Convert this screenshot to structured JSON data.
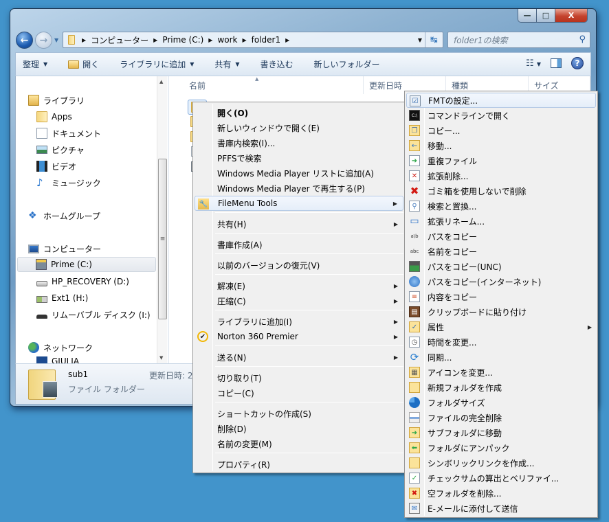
{
  "window": {
    "caption_buttons": {
      "minimize": "—",
      "maximize": "□",
      "close": "X"
    },
    "nav": {
      "back_icon": "back-arrow-icon",
      "forward_icon": "forward-arrow-icon"
    },
    "address": {
      "segments": [
        "コンピューター",
        "Prime (C:)",
        "work",
        "folder1"
      ],
      "separator": "▶"
    },
    "search": {
      "placeholder": "folder1の検索"
    },
    "toolbar": {
      "organize": "整理",
      "open": "開く",
      "add_to_library": "ライブラリに追加",
      "share": "共有",
      "burn": "書き込む",
      "new_folder": "新しいフォルダー"
    },
    "nav_pane": {
      "libraries": "ライブラリ",
      "lib_items": [
        "Apps",
        "ドキュメント",
        "ピクチャ",
        "ビデオ",
        "ミュージック"
      ],
      "homegroup": "ホームグループ",
      "computer": "コンピューター",
      "drives": [
        "Prime (C:)",
        "HP_RECOVERY (D:)",
        "Ext1 (H:)",
        "リムーバブル ディスク (I:)"
      ],
      "network": "ネットワーク",
      "network_items": [
        "GIULIA"
      ]
    },
    "columns": [
      "名前",
      "更新日時",
      "種類",
      "サイズ"
    ],
    "status": {
      "name": "sub1",
      "type": "ファイル フォルダー",
      "modified_label": "更新日時: 2"
    }
  },
  "context_menu": {
    "items": [
      {
        "label": "開く(O)",
        "bold": true
      },
      {
        "label": "新しいウィンドウで開く(E)"
      },
      {
        "label": "書庫内検索(I)..."
      },
      {
        "label": "PFFSで検索"
      },
      {
        "label": "Windows Media Player リストに追加(A)"
      },
      {
        "label": "Windows Media Player で再生する(P)"
      },
      {
        "label": "FileMenu Tools",
        "submenu": true,
        "highlighted": true,
        "icon": "filemenu-tools-icon"
      },
      {
        "label": "共有(H)",
        "submenu": true
      },
      {
        "label": "書庫作成(A)"
      },
      {
        "label": "以前のバージョンの復元(V)"
      },
      {
        "label": "解凍(E)",
        "submenu": true
      },
      {
        "label": "圧縮(C)",
        "submenu": true
      },
      {
        "label": "ライブラリに追加(I)",
        "submenu": true
      },
      {
        "label": "Norton 360 Premier",
        "submenu": true,
        "icon": "norton-icon"
      },
      {
        "label": "送る(N)",
        "submenu": true
      },
      {
        "label": "切り取り(T)"
      },
      {
        "label": "コピー(C)"
      },
      {
        "label": "ショートカットの作成(S)"
      },
      {
        "label": "削除(D)"
      },
      {
        "label": "名前の変更(M)"
      },
      {
        "label": "プロパティ(R)"
      }
    ]
  },
  "submenu": {
    "items": [
      {
        "label": "FMTの設定...",
        "icon": "settings-icon",
        "highlighted": true
      },
      {
        "label": "コマンドラインで開く",
        "icon": "command-prompt-icon"
      },
      {
        "label": "コピー...",
        "icon": "copy-icon"
      },
      {
        "label": "移動...",
        "icon": "move-icon"
      },
      {
        "label": "重複ファイル",
        "icon": "duplicate-file-icon"
      },
      {
        "label": "拡張削除...",
        "icon": "advanced-delete-icon"
      },
      {
        "label": "ゴミ箱を使用しないで削除",
        "icon": "delete-x-icon"
      },
      {
        "label": "検索と置換...",
        "icon": "find-replace-icon"
      },
      {
        "label": "拡張リネーム...",
        "icon": "rename-icon"
      },
      {
        "label": "パスをコピー",
        "icon": "copy-path-icon"
      },
      {
        "label": "名前をコピー",
        "icon": "copy-name-icon"
      },
      {
        "label": "パスをコピー(UNC)",
        "icon": "copy-unc-path-icon"
      },
      {
        "label": "パスをコピー(インターネット)",
        "icon": "copy-internet-path-icon"
      },
      {
        "label": "内容をコピー",
        "icon": "copy-content-icon"
      },
      {
        "label": "クリップボードに貼り付け",
        "icon": "clipboard-icon"
      },
      {
        "label": "属性",
        "icon": "attributes-icon",
        "submenu": true
      },
      {
        "label": "時間を変更...",
        "icon": "clock-icon"
      },
      {
        "label": "同期...",
        "icon": "sync-icon"
      },
      {
        "label": "アイコンを変更...",
        "icon": "change-icon-icon"
      },
      {
        "label": "新規フォルダを作成",
        "icon": "new-folder-icon"
      },
      {
        "label": "フォルダサイズ",
        "icon": "pie-chart-icon"
      },
      {
        "label": "ファイルの完全削除",
        "icon": "shredder-icon"
      },
      {
        "label": "サブフォルダに移動",
        "icon": "move-to-subfolder-icon"
      },
      {
        "label": "フォルダにアンパック",
        "icon": "unpack-folder-icon"
      },
      {
        "label": "シンボリックリンクを作成...",
        "icon": "symlink-icon"
      },
      {
        "label": "チェックサムの算出とベリファイ...",
        "icon": "checksum-icon"
      },
      {
        "label": "空フォルダを削除...",
        "icon": "delete-empty-folder-icon"
      },
      {
        "label": "E-メールに添付して送信",
        "icon": "email-icon"
      }
    ]
  },
  "colors": {
    "desktop": "#4294cb",
    "menu_bg": "#f0f0f0",
    "highlight_border": "#b6cbe6"
  }
}
